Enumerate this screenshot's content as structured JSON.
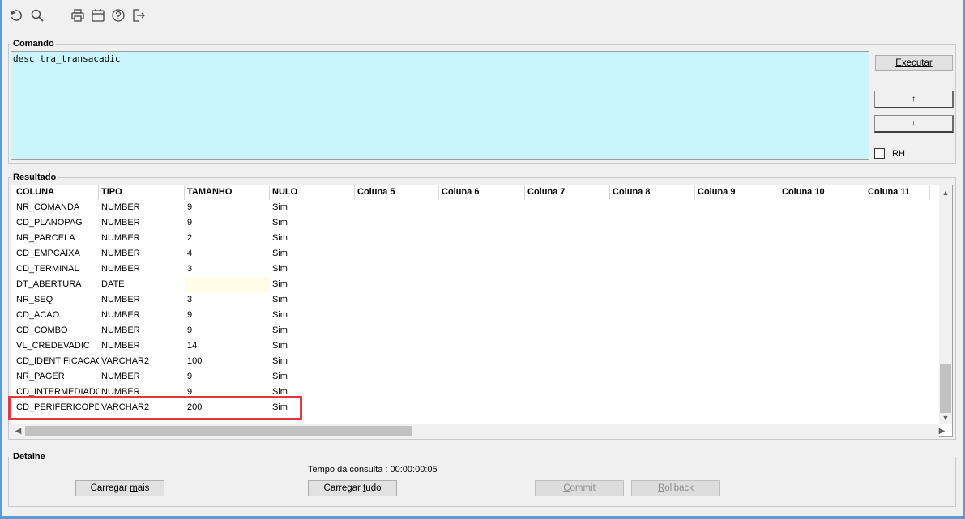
{
  "toolbar": {
    "icons": [
      "undo-icon",
      "search-icon",
      "print-icon",
      "calendar-icon",
      "help-icon",
      "exit-icon"
    ]
  },
  "comando": {
    "legend": "Comando",
    "text": "desc tra_transacadic",
    "executar_label": "Executar",
    "up_label": "↑",
    "down_label": "↓",
    "rh_label": "RH"
  },
  "resultado": {
    "legend": "Resultado",
    "columns": [
      "COLUNA",
      "TIPO",
      "TAMANHO",
      "NULO",
      "Coluna 5",
      "Coluna 6",
      "Coluna 7",
      "Coluna 8",
      "Coluna 9",
      "Coluna 10",
      "Coluna 11"
    ],
    "rows": [
      [
        "NR_COMANDA",
        "NUMBER",
        "9",
        "Sim"
      ],
      [
        "CD_PLANOPAG",
        "NUMBER",
        "9",
        "Sim"
      ],
      [
        "NR_PARCELA",
        "NUMBER",
        "2",
        "Sim"
      ],
      [
        "CD_EMPCAIXA",
        "NUMBER",
        "4",
        "Sim"
      ],
      [
        "CD_TERMINAL",
        "NUMBER",
        "3",
        "Sim"
      ],
      [
        "DT_ABERTURA",
        "DATE",
        "",
        "Sim"
      ],
      [
        "NR_SEQ",
        "NUMBER",
        "3",
        "Sim"
      ],
      [
        "CD_ACAO",
        "NUMBER",
        "9",
        "Sim"
      ],
      [
        "CD_COMBO",
        "NUMBER",
        "9",
        "Sim"
      ],
      [
        "VL_CREDEVADIC",
        "NUMBER",
        "14",
        "Sim"
      ],
      [
        "CD_IDENTIFICACAO",
        "VARCHAR2",
        "100",
        "Sim"
      ],
      [
        "NR_PAGER",
        "NUMBER",
        "9",
        "Sim"
      ],
      [
        "CD_INTERMEDIADOR",
        "NUMBER",
        "9",
        "Sim"
      ],
      [
        "CD_PERIFERICOPDV",
        "VARCHAR2",
        "200",
        "Sim"
      ]
    ]
  },
  "detalhe": {
    "legend": "Detalhe",
    "tempo": "Tempo da consulta : 00:00:00:05",
    "carregar_mais_pre": "Carregar ",
    "carregar_mais_acc": "m",
    "carregar_mais_post": "ais",
    "carregar_tudo_pre": "Carregar ",
    "carregar_tudo_acc": "t",
    "carregar_tudo_post": "udo",
    "commit_acc": "C",
    "commit_post": "ommit",
    "rollback_acc": "R",
    "rollback_post": "ollback"
  },
  "colors": {
    "command_bg": "#c8f6fc",
    "highlight_border": "#e8363d",
    "window_border": "#5b9bd5"
  }
}
